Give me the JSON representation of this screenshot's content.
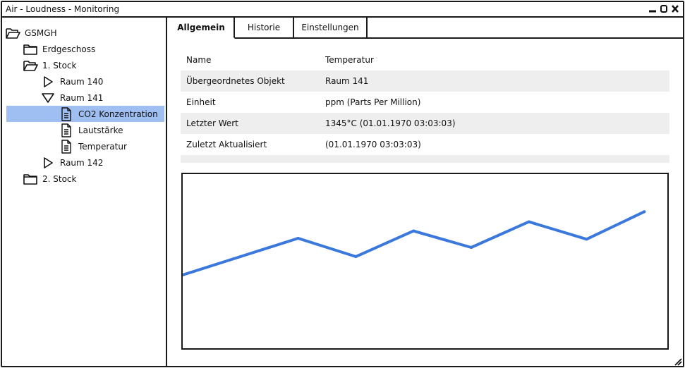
{
  "window": {
    "title": "Air - Loudness - Monitoring",
    "controls": [
      "minimize-icon",
      "maximize-icon",
      "close-icon"
    ]
  },
  "tree": [
    {
      "label": "GSMGH",
      "icon": "folder-open-icon",
      "level": 0
    },
    {
      "label": "Erdgeschoss",
      "icon": "folder-icon",
      "level": 1
    },
    {
      "label": "1. Stock",
      "icon": "folder-open-icon",
      "level": 1
    },
    {
      "label": "Raum 140",
      "icon": "triangle-right-icon",
      "level": 2
    },
    {
      "label": "Raum 141",
      "icon": "triangle-down-icon",
      "level": 2
    },
    {
      "label": "CO2 Konzentration",
      "icon": "document-icon",
      "level": 3,
      "selected": true
    },
    {
      "label": "Lautstärke",
      "icon": "document-icon",
      "level": 3
    },
    {
      "label": "Temperatur",
      "icon": "document-icon",
      "level": 3
    },
    {
      "label": "Raum 142",
      "icon": "triangle-right-icon",
      "level": 2
    },
    {
      "label": "2. Stock",
      "icon": "folder-icon",
      "level": 1
    }
  ],
  "tabs": [
    {
      "label": "Allgemein",
      "active": true
    },
    {
      "label": "Historie",
      "active": false
    },
    {
      "label": "Einstellungen",
      "active": false
    }
  ],
  "properties": [
    {
      "label": "Name",
      "value": "Temperatur"
    },
    {
      "label": "Übergeordnetes Objekt",
      "value": "Raum 141"
    },
    {
      "label": "Einheit",
      "value": "ppm (Parts Per Million)"
    },
    {
      "label": "Letzter Wert",
      "value": "1345°C (01.01.1970 03:03:03)"
    },
    {
      "label": "Zuletzt Aktualisiert",
      "value": "(01.01.1970 03:03:03)"
    }
  ],
  "chart_data": {
    "type": "line",
    "title": "",
    "xlabel": "",
    "ylabel": "",
    "grid": false,
    "x": [
      0,
      1,
      2,
      3,
      4,
      5,
      6,
      7,
      8
    ],
    "y": [
      0.0,
      0.2,
      0.4,
      0.2,
      0.48,
      0.3,
      0.58,
      0.39,
      0.69
    ],
    "xlim": [
      0,
      8.4
    ],
    "ylim": [
      -0.8,
      1.1
    ],
    "line_color": "#3a78dc"
  },
  "colors": {
    "selection": "#9fbff2",
    "border": "#1a1a1a",
    "row_alt": "#eeeeee"
  }
}
